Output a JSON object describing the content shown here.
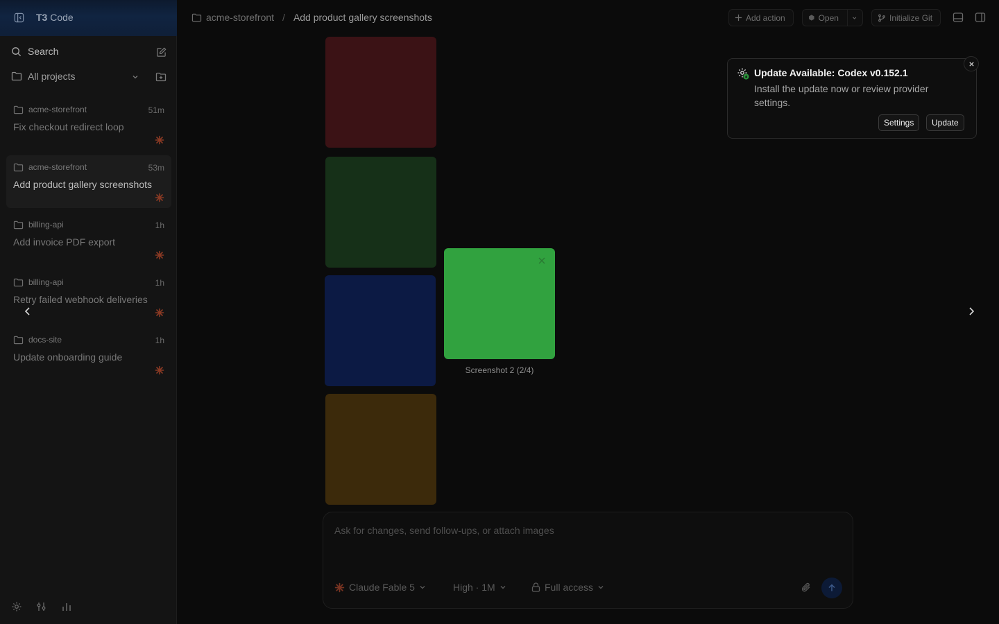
{
  "sidebar": {
    "brand": "T3",
    "brand_suffix": "Code",
    "search_label": "Search",
    "projects_label": "All projects",
    "threads": [
      {
        "project": "acme-storefront",
        "time": "51m",
        "title": "Fix checkout redirect loop"
      },
      {
        "project": "acme-storefront",
        "time": "53m",
        "title": "Add product gallery screenshots"
      },
      {
        "project": "billing-api",
        "time": "1h",
        "title": "Add invoice PDF export"
      },
      {
        "project": "billing-api",
        "time": "1h",
        "title": "Retry failed webhook deliveries"
      },
      {
        "project": "docs-site",
        "time": "1h",
        "title": "Update onboarding guide"
      }
    ]
  },
  "header": {
    "project": "acme-storefront",
    "separator": "/",
    "thread_title": "Add product gallery screenshots",
    "add_action": "Add action",
    "open": "Open",
    "init_git": "Initialize Git"
  },
  "lightbox": {
    "caption": "Screenshot 2 (2/4)",
    "accent": "#31a23f"
  },
  "composer": {
    "placeholder": "Ask for changes, send follow-ups, or attach images",
    "model": "Claude Fable 5",
    "effort": "High · 1M",
    "access": "Full access"
  },
  "toast": {
    "title": "Update Available: Codex v0.152.1",
    "description": "Install the update now or review provider settings.",
    "settings_label": "Settings",
    "update_label": "Update"
  }
}
